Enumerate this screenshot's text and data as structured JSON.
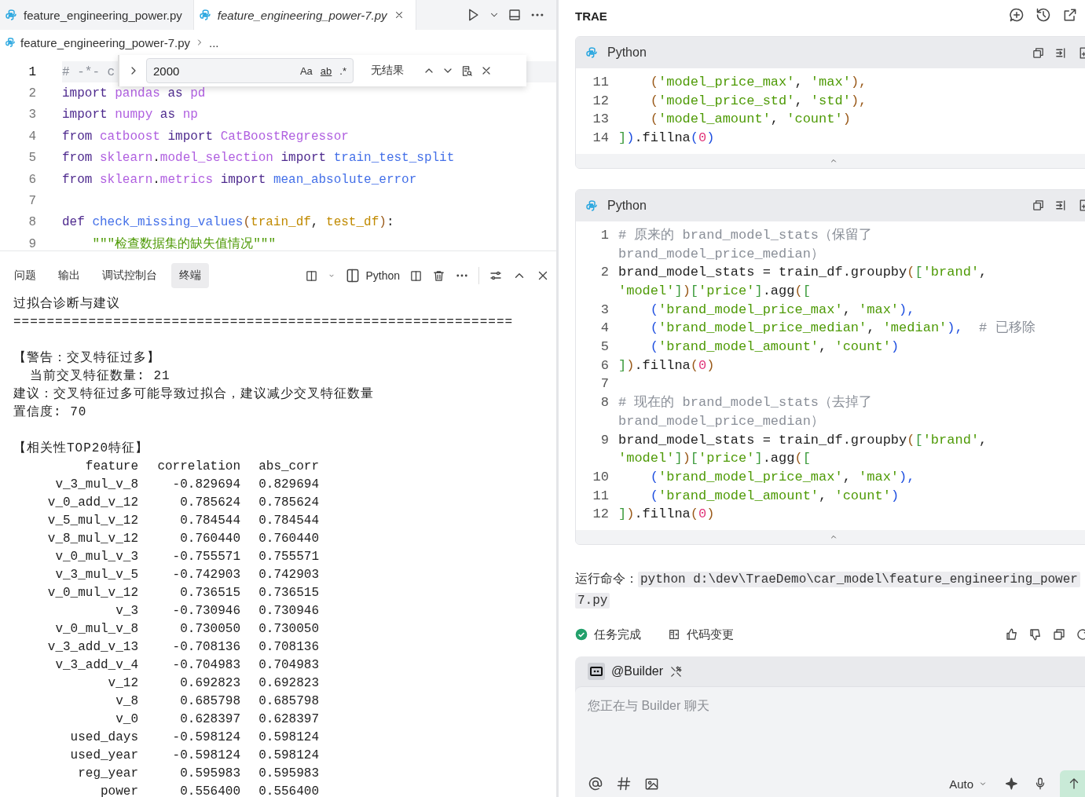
{
  "editor_tabs": [
    {
      "label": "feature_engineering_power.py",
      "selected": false,
      "preview": false
    },
    {
      "label": "feature_engineering_power-7.py",
      "selected": true,
      "preview": true
    }
  ],
  "breadcrumb": [
    "feature_engineering_power-7.py",
    "..."
  ],
  "find": {
    "value": "2000",
    "options": [
      "Aa",
      "ab",
      ".*"
    ],
    "result": "无结果"
  },
  "editor": {
    "lines": [
      {
        "number": "1",
        "active": true,
        "tokens": [
          {
            "kind": "cmt",
            "text": "# -*- c"
          }
        ]
      },
      {
        "number": "2",
        "active": false,
        "tokens": [
          {
            "kind": "kw",
            "text": "import "
          },
          {
            "kind": "mod",
            "text": "pandas "
          },
          {
            "kind": "kw",
            "text": "as "
          },
          {
            "kind": "mod",
            "text": "pd"
          }
        ]
      },
      {
        "number": "3",
        "active": false,
        "tokens": [
          {
            "kind": "kw",
            "text": "import "
          },
          {
            "kind": "mod",
            "text": "numpy "
          },
          {
            "kind": "kw",
            "text": "as "
          },
          {
            "kind": "mod",
            "text": "np"
          }
        ]
      },
      {
        "number": "4",
        "active": false,
        "tokens": [
          {
            "kind": "kw",
            "text": "from "
          },
          {
            "kind": "mod",
            "text": "catboost "
          },
          {
            "kind": "kw",
            "text": "import "
          },
          {
            "kind": "mod",
            "text": "CatBoostRegressor"
          }
        ]
      },
      {
        "number": "5",
        "active": false,
        "tokens": [
          {
            "kind": "kw",
            "text": "from "
          },
          {
            "kind": "mod",
            "text": "sklearn"
          },
          {
            "kind": "plain",
            "text": "."
          },
          {
            "kind": "mod",
            "text": "model_selection "
          },
          {
            "kind": "kw",
            "text": "import "
          },
          {
            "kind": "fn",
            "text": "train_test_split"
          }
        ]
      },
      {
        "number": "6",
        "active": false,
        "tokens": [
          {
            "kind": "kw",
            "text": "from "
          },
          {
            "kind": "mod",
            "text": "sklearn"
          },
          {
            "kind": "plain",
            "text": "."
          },
          {
            "kind": "mod",
            "text": "metrics "
          },
          {
            "kind": "kw",
            "text": "import "
          },
          {
            "kind": "fn",
            "text": "mean_absolute_error"
          }
        ]
      },
      {
        "number": "7",
        "active": false
      },
      {
        "number": "8",
        "active": false,
        "tokens": [
          {
            "kind": "kw",
            "text": "def "
          },
          {
            "kind": "fn",
            "text": "check_missing_values"
          },
          {
            "kind": "p1",
            "text": "("
          },
          {
            "kind": "param",
            "text": "train_df"
          },
          {
            "kind": "plain",
            "text": ", "
          },
          {
            "kind": "param",
            "text": "test_df"
          },
          {
            "kind": "p1",
            "text": ")"
          },
          {
            "kind": "plain",
            "text": ":"
          }
        ]
      },
      {
        "number": "9",
        "active": false,
        "tokens": [
          {
            "kind": "str",
            "text": "    \"\"\"检查数据集的缺失值情况\"\"\""
          }
        ]
      }
    ]
  },
  "panel": {
    "tabs": [
      {
        "label": "问题",
        "selected": false
      },
      {
        "label": "输出",
        "selected": false
      },
      {
        "label": "调试控制台",
        "selected": false
      },
      {
        "label": "终端",
        "selected": true
      }
    ],
    "profile": "Python"
  },
  "terminal": {
    "blocks": [
      {
        "lines": [
          "过拟合诊断与建议",
          "============================================================"
        ]
      },
      {
        "lines": [
          "【警告：交叉特征过多】",
          "  当前交叉特征数量: 21",
          "建议：交叉特征过多可能导致过拟合，建议减少交叉特征数量",
          "置信度: 70"
        ]
      },
      {
        "lines": [
          "【相关性TOP20特征】"
        ]
      }
    ],
    "table": {
      "columns": [
        "feature",
        "correlation",
        "abs_corr"
      ],
      "rows": [
        [
          "v_3_mul_v_8",
          "-0.829694",
          "0.829694"
        ],
        [
          "v_0_add_v_12",
          "0.785624",
          "0.785624"
        ],
        [
          "v_5_mul_v_12",
          "0.784544",
          "0.784544"
        ],
        [
          "v_8_mul_v_12",
          "0.760440",
          "0.760440"
        ],
        [
          "v_0_mul_v_3",
          "-0.755571",
          "0.755571"
        ],
        [
          "v_3_mul_v_5",
          "-0.742903",
          "0.742903"
        ],
        [
          "v_0_mul_v_12",
          "0.736515",
          "0.736515"
        ],
        [
          "v_3",
          "-0.730946",
          "0.730946"
        ],
        [
          "v_0_mul_v_8",
          "0.730050",
          "0.730050"
        ],
        [
          "v_3_add_v_13",
          "-0.708136",
          "0.708136"
        ],
        [
          "v_3_add_v_4",
          "-0.704983",
          "0.704983"
        ],
        [
          "v_12",
          "0.692823",
          "0.692823"
        ],
        [
          "v_8",
          "0.685798",
          "0.685798"
        ],
        [
          "v_0",
          "0.628397",
          "0.628397"
        ],
        [
          "used_days",
          "-0.598124",
          "0.598124"
        ],
        [
          "used_year",
          "-0.598124",
          "0.598124"
        ],
        [
          "reg_year",
          "0.595983",
          "0.595983"
        ],
        [
          "power",
          "0.556400",
          "0.556400"
        ]
      ]
    }
  },
  "assistant": {
    "title": "TRAE",
    "code_blocks": [
      {
        "language": "Python",
        "lines": [
          {
            "number": "11",
            "tokens": [
              {
                "kind": "p1",
                "text": "    ("
              },
              {
                "kind": "str",
                "text": "'model_price_max'"
              },
              {
                "kind": "plain",
                "text": ", "
              },
              {
                "kind": "str",
                "text": "'max'"
              },
              {
                "kind": "p1",
                "text": "),"
              }
            ]
          },
          {
            "number": "12",
            "tokens": [
              {
                "kind": "p1",
                "text": "    ("
              },
              {
                "kind": "str",
                "text": "'model_price_std'"
              },
              {
                "kind": "plain",
                "text": ", "
              },
              {
                "kind": "str",
                "text": "'std'"
              },
              {
                "kind": "p1",
                "text": "),"
              }
            ]
          },
          {
            "number": "13",
            "tokens": [
              {
                "kind": "p1",
                "text": "    ("
              },
              {
                "kind": "str",
                "text": "'model_amount'"
              },
              {
                "kind": "plain",
                "text": ", "
              },
              {
                "kind": "str",
                "text": "'count'"
              },
              {
                "kind": "p1",
                "text": ")"
              }
            ]
          },
          {
            "number": "14",
            "tokens": [
              {
                "kind": "b",
                "text": "]"
              },
              {
                "kind": "p2",
                "text": ")"
              },
              {
                "kind": "plain",
                "text": ".fillna"
              },
              {
                "kind": "p2",
                "text": "("
              },
              {
                "kind": "num",
                "text": "0"
              },
              {
                "kind": "p2",
                "text": ")"
              }
            ]
          }
        ]
      },
      {
        "language": "Python",
        "lines": [
          {
            "number": "1",
            "tokens": [
              {
                "kind": "cmt",
                "text": "# 原来的 brand_model_stats（保留了"
              },
              {
                "kind": "break"
              },
              {
                "kind": "cmt",
                "text": "brand_model_price_median）"
              }
            ]
          },
          {
            "number": "2",
            "tokens": [
              {
                "kind": "plain",
                "text": "brand_model_stats = train_df.groupby"
              },
              {
                "kind": "p1",
                "text": "("
              },
              {
                "kind": "b",
                "text": "["
              },
              {
                "kind": "str",
                "text": "'brand'"
              },
              {
                "kind": "plain",
                "text": ","
              },
              {
                "kind": "break"
              },
              {
                "kind": "str",
                "text": "'model'"
              },
              {
                "kind": "b",
                "text": "]"
              },
              {
                "kind": "p1",
                "text": ")"
              },
              {
                "kind": "b",
                "text": "["
              },
              {
                "kind": "str",
                "text": "'price'"
              },
              {
                "kind": "b",
                "text": "]"
              },
              {
                "kind": "plain",
                "text": ".agg"
              },
              {
                "kind": "p1",
                "text": "("
              },
              {
                "kind": "b",
                "text": "["
              }
            ]
          },
          {
            "number": "3",
            "tokens": [
              {
                "kind": "p2",
                "text": "    ("
              },
              {
                "kind": "str",
                "text": "'brand_model_price_max'"
              },
              {
                "kind": "plain",
                "text": ", "
              },
              {
                "kind": "str",
                "text": "'max'"
              },
              {
                "kind": "p2",
                "text": "),"
              }
            ]
          },
          {
            "number": "4",
            "tokens": [
              {
                "kind": "p2",
                "text": "    ("
              },
              {
                "kind": "str",
                "text": "'brand_model_price_median'"
              },
              {
                "kind": "plain",
                "text": ", "
              },
              {
                "kind": "str",
                "text": "'median'"
              },
              {
                "kind": "p2",
                "text": "),"
              },
              {
                "kind": "cmt",
                "text": "  # 已移除"
              }
            ]
          },
          {
            "number": "5",
            "tokens": [
              {
                "kind": "p2",
                "text": "    ("
              },
              {
                "kind": "str",
                "text": "'brand_model_amount'"
              },
              {
                "kind": "plain",
                "text": ", "
              },
              {
                "kind": "str",
                "text": "'count'"
              },
              {
                "kind": "p2",
                "text": ")"
              }
            ]
          },
          {
            "number": "6",
            "tokens": [
              {
                "kind": "b",
                "text": "]"
              },
              {
                "kind": "p1",
                "text": ")"
              },
              {
                "kind": "plain",
                "text": ".fillna"
              },
              {
                "kind": "p1",
                "text": "("
              },
              {
                "kind": "num",
                "text": "0"
              },
              {
                "kind": "p1",
                "text": ")"
              }
            ]
          },
          {
            "number": "7"
          },
          {
            "number": "8",
            "tokens": [
              {
                "kind": "cmt",
                "text": "# 现在的 brand_model_stats（去掉了"
              },
              {
                "kind": "break"
              },
              {
                "kind": "cmt",
                "text": "brand_model_price_median）"
              }
            ]
          },
          {
            "number": "9",
            "tokens": [
              {
                "kind": "plain",
                "text": "brand_model_stats = train_df.groupby"
              },
              {
                "kind": "p1",
                "text": "("
              },
              {
                "kind": "b",
                "text": "["
              },
              {
                "kind": "str",
                "text": "'brand'"
              },
              {
                "kind": "plain",
                "text": ","
              },
              {
                "kind": "break"
              },
              {
                "kind": "str",
                "text": "'model'"
              },
              {
                "kind": "b",
                "text": "]"
              },
              {
                "kind": "p1",
                "text": ")"
              },
              {
                "kind": "b",
                "text": "["
              },
              {
                "kind": "str",
                "text": "'price'"
              },
              {
                "kind": "b",
                "text": "]"
              },
              {
                "kind": "plain",
                "text": ".agg"
              },
              {
                "kind": "p1",
                "text": "("
              },
              {
                "kind": "b",
                "text": "["
              }
            ]
          },
          {
            "number": "10",
            "tokens": [
              {
                "kind": "p2",
                "text": "    ("
              },
              {
                "kind": "str",
                "text": "'brand_model_price_max'"
              },
              {
                "kind": "plain",
                "text": ", "
              },
              {
                "kind": "str",
                "text": "'max'"
              },
              {
                "kind": "p2",
                "text": "),"
              }
            ]
          },
          {
            "number": "11",
            "tokens": [
              {
                "kind": "p2",
                "text": "    ("
              },
              {
                "kind": "str",
                "text": "'brand_model_amount'"
              },
              {
                "kind": "plain",
                "text": ", "
              },
              {
                "kind": "str",
                "text": "'count'"
              },
              {
                "kind": "p2",
                "text": ")"
              }
            ]
          },
          {
            "number": "12",
            "tokens": [
              {
                "kind": "b",
                "text": "]"
              },
              {
                "kind": "p1",
                "text": ")"
              },
              {
                "kind": "plain",
                "text": ".fillna"
              },
              {
                "kind": "p1",
                "text": "("
              },
              {
                "kind": "num",
                "text": "0"
              },
              {
                "kind": "p1",
                "text": ")"
              }
            ]
          }
        ]
      }
    ],
    "command_label": "运行命令：",
    "command_lines": [
      "python d:\\dev\\TraeDemo\\car_model\\feature_engineering_power",
      "7.py"
    ],
    "status": "任务完成",
    "changes": "代码变更",
    "chat": {
      "agent": "@Builder",
      "placeholder": "您正在与 Builder 聊天",
      "model": "Auto"
    }
  }
}
